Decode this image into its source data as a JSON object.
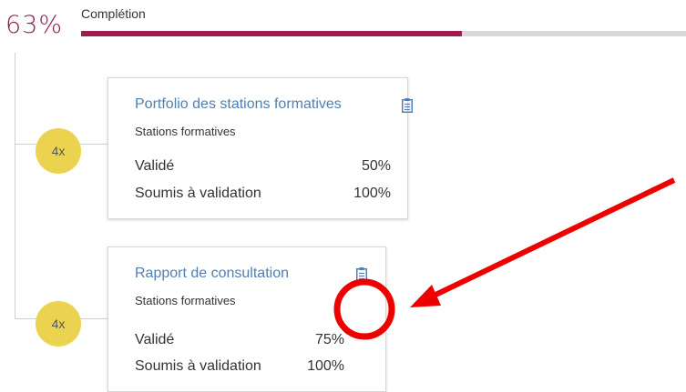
{
  "progress": {
    "percent_text": "63%",
    "label": "Complétion",
    "value": 0.63
  },
  "items": [
    {
      "badge": "4x",
      "title": "Portfolio des stations formatives",
      "subtitle": "Stations formatives",
      "rows": [
        {
          "label": "Validé",
          "value": "50%"
        },
        {
          "label": "Soumis à validation",
          "value": "100%"
        }
      ],
      "icon": "clipboard-icon"
    },
    {
      "badge": "4x",
      "title": "Rapport de consultation",
      "subtitle": "Stations formatives",
      "rows": [
        {
          "label": "Validé",
          "value": "75%"
        },
        {
          "label": "Soumis à validation",
          "value": "100%"
        }
      ],
      "icon": "clipboard-icon"
    }
  ],
  "colors": {
    "accent": "#9b1c51",
    "badge": "#ecd34f",
    "link": "#4f7fb3",
    "annotation": "#ee0000"
  }
}
